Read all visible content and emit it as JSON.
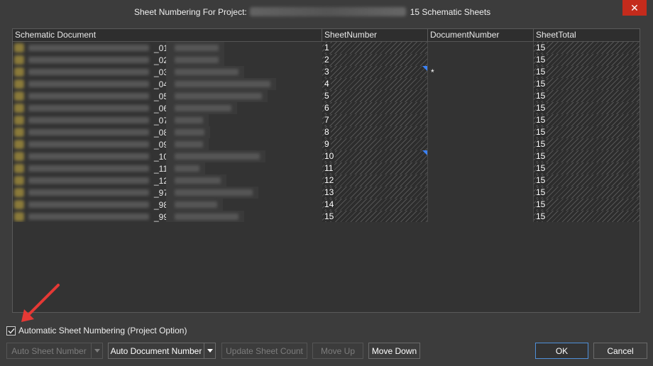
{
  "dialog": {
    "title_prefix": "Sheet Numbering For Project:",
    "sheet_count_text": "15 Schematic Sheets",
    "close_label": "✕"
  },
  "table": {
    "headers": [
      "Schematic Document",
      "SheetNumber",
      "DocumentNumber",
      "SheetTotal"
    ],
    "rows": [
      {
        "num": "_01",
        "sheet": "1",
        "doc": "",
        "total": "15",
        "marker": false
      },
      {
        "num": "_02",
        "sheet": "2",
        "doc": "",
        "total": "15",
        "marker": false
      },
      {
        "num": "_03",
        "sheet": "3",
        "doc": "*",
        "total": "15",
        "marker": true
      },
      {
        "num": "_04",
        "sheet": "4",
        "doc": "",
        "total": "15",
        "marker": false
      },
      {
        "num": "_05",
        "sheet": "5",
        "doc": "",
        "total": "15",
        "marker": false
      },
      {
        "num": "_06",
        "sheet": "6",
        "doc": "",
        "total": "15",
        "marker": false
      },
      {
        "num": "_07",
        "sheet": "7",
        "doc": "",
        "total": "15",
        "marker": false
      },
      {
        "num": "_08",
        "sheet": "8",
        "doc": "",
        "total": "15",
        "marker": false
      },
      {
        "num": "_09",
        "sheet": "9",
        "doc": "",
        "total": "15",
        "marker": false
      },
      {
        "num": "_10",
        "sheet": "10",
        "doc": "",
        "total": "15",
        "marker": true
      },
      {
        "num": "_11",
        "sheet": "11",
        "doc": "",
        "total": "15",
        "marker": false
      },
      {
        "num": "_12",
        "sheet": "12",
        "doc": "",
        "total": "15",
        "marker": false
      },
      {
        "num": "_97",
        "sheet": "13",
        "doc": "",
        "total": "15",
        "marker": false
      },
      {
        "num": "_98",
        "sheet": "14",
        "doc": "",
        "total": "15",
        "marker": false
      },
      {
        "num": "_99",
        "sheet": "15",
        "doc": "",
        "total": "15",
        "marker": false
      }
    ]
  },
  "option": {
    "label": "Automatic Sheet Numbering (Project Option)",
    "checked": true
  },
  "buttons": {
    "auto_sheet_number": "Auto Sheet Number",
    "auto_document_number": "Auto Document Number",
    "update_sheet_count": "Update Sheet Count",
    "move_up": "Move Up",
    "move_down": "Move Down",
    "ok": "OK",
    "cancel": "Cancel"
  },
  "colors": {
    "accent": "#4f8fd8",
    "close": "#c42b1c",
    "annotation_arrow": "#e53935"
  }
}
